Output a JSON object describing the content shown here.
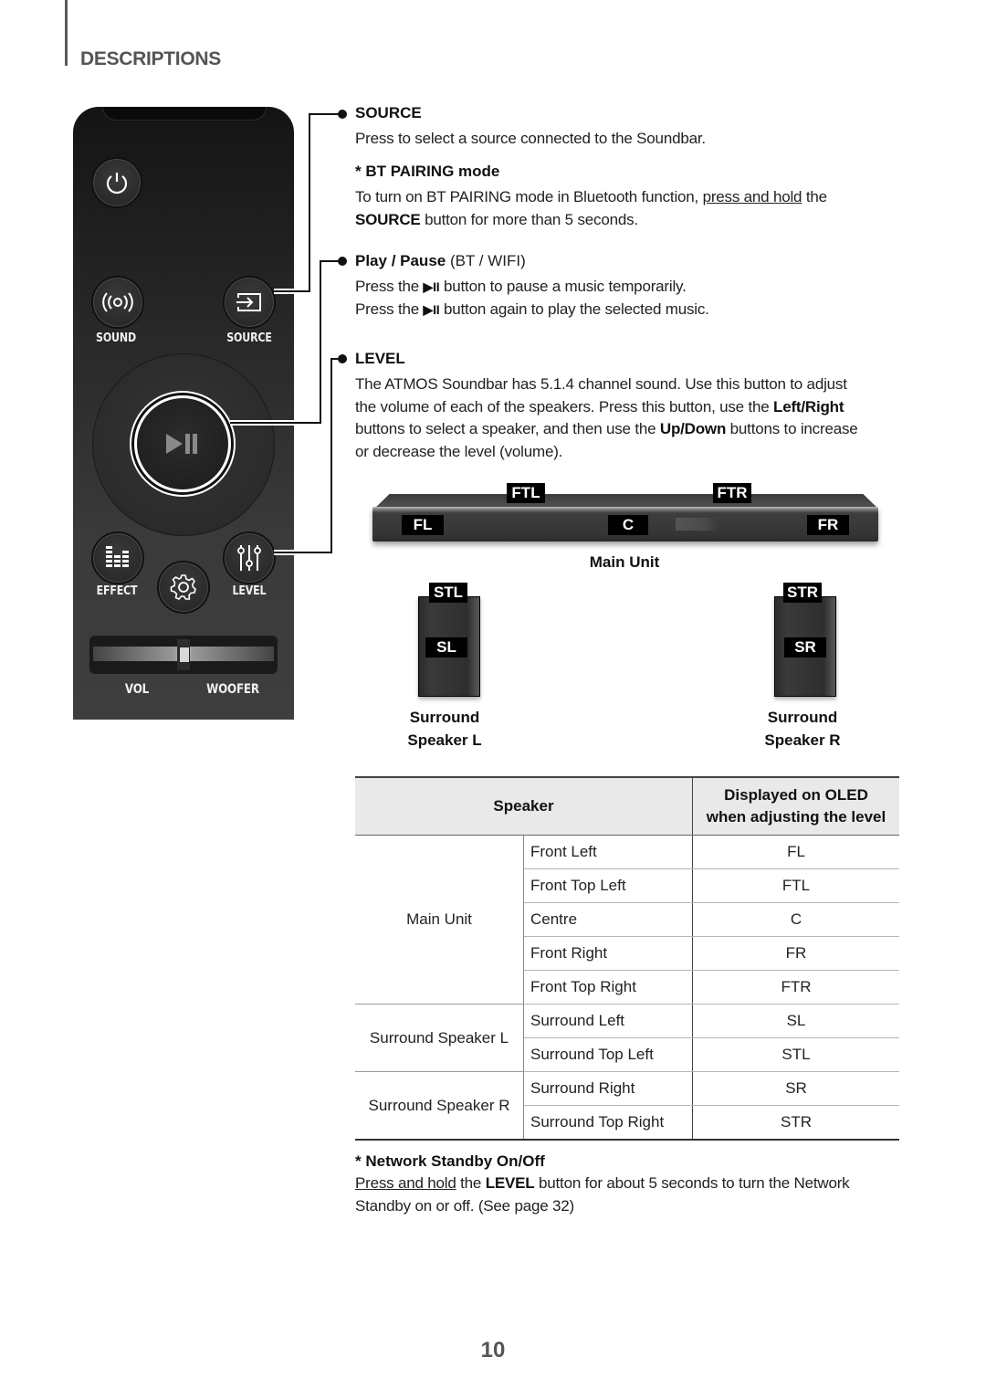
{
  "section_title": "DESCRIPTIONS",
  "remote": {
    "buttons": {
      "sound_label": "SOUND",
      "source_label": "SOURCE",
      "effect_label": "EFFECT",
      "level_label": "LEVEL",
      "vol_label": "VOL",
      "woofer_label": "WOOFER"
    }
  },
  "source": {
    "title": "SOURCE",
    "desc": "Press to select a source connected to the Soundbar.",
    "bt_title": "* BT PAIRING mode",
    "bt_text_1": "To turn on BT PAIRING mode in Bluetooth function, ",
    "bt_text_link": "press and hold",
    "bt_text_2": " the",
    "bt_text_bold": "SOURCE",
    "bt_text_3": " button for more than 5 seconds."
  },
  "play_pause": {
    "title_bold": "Play / Pause",
    "title_rest": " (BT / WIFI)",
    "line1_a": "Press the ",
    "glyph": "▶II",
    "line1_b": " button to pause a music temporarily.",
    "line2_a": "Press the ",
    "line2_b": " button again to play the selected music."
  },
  "level": {
    "title": "LEVEL",
    "p1": "The ATMOS Soundbar has 5.1.4 channel sound. Use this button to adjust",
    "p2_a": "the volume of each of the speakers. Press this button, use the ",
    "p2_b": "Left/Right",
    "p3_a": "buttons to select a speaker, and then use the ",
    "p3_b": "Up/Down",
    "p3_c": " buttons to increase",
    "p4": "or decrease the level (volume)."
  },
  "diagram": {
    "tags": {
      "ftl": "FTL",
      "ftr": "FTR",
      "fl": "FL",
      "c": "C",
      "fr": "FR",
      "stl": "STL",
      "str": "STR",
      "sl": "SL",
      "sr": "SR"
    },
    "main_unit_caption": "Main Unit",
    "surround_l_caption_1": "Surround",
    "surround_l_caption_2": "Speaker L",
    "surround_r_caption_1": "Surround",
    "surround_r_caption_2": "Speaker R"
  },
  "table": {
    "headers": {
      "speaker": "Speaker",
      "display_1": "Displayed on OLED",
      "display_2": "when adjusting the level"
    },
    "groups": [
      {
        "name": "Main Unit",
        "rows": [
          {
            "speaker": "Front Left",
            "code": "FL"
          },
          {
            "speaker": "Front Top Left",
            "code": "FTL"
          },
          {
            "speaker": "Centre",
            "code": "C"
          },
          {
            "speaker": "Front Right",
            "code": "FR"
          },
          {
            "speaker": "Front Top Right",
            "code": "FTR"
          }
        ]
      },
      {
        "name": "Surround Speaker L",
        "rows": [
          {
            "speaker": "Surround Left",
            "code": "SL"
          },
          {
            "speaker": "Surround Top Left",
            "code": "STL"
          }
        ]
      },
      {
        "name": "Surround Speaker R",
        "rows": [
          {
            "speaker": "Surround Right",
            "code": "SR"
          },
          {
            "speaker": "Surround Top Right",
            "code": "STR"
          }
        ]
      }
    ]
  },
  "network": {
    "title": "* Network Standby On/Off",
    "link": "Press and hold",
    "t1": " the ",
    "bold": "LEVEL",
    "t2": " button for about 5 seconds to turn the Network",
    "t3": "Standby on or off. (See page 32)"
  },
  "page_number": "10"
}
